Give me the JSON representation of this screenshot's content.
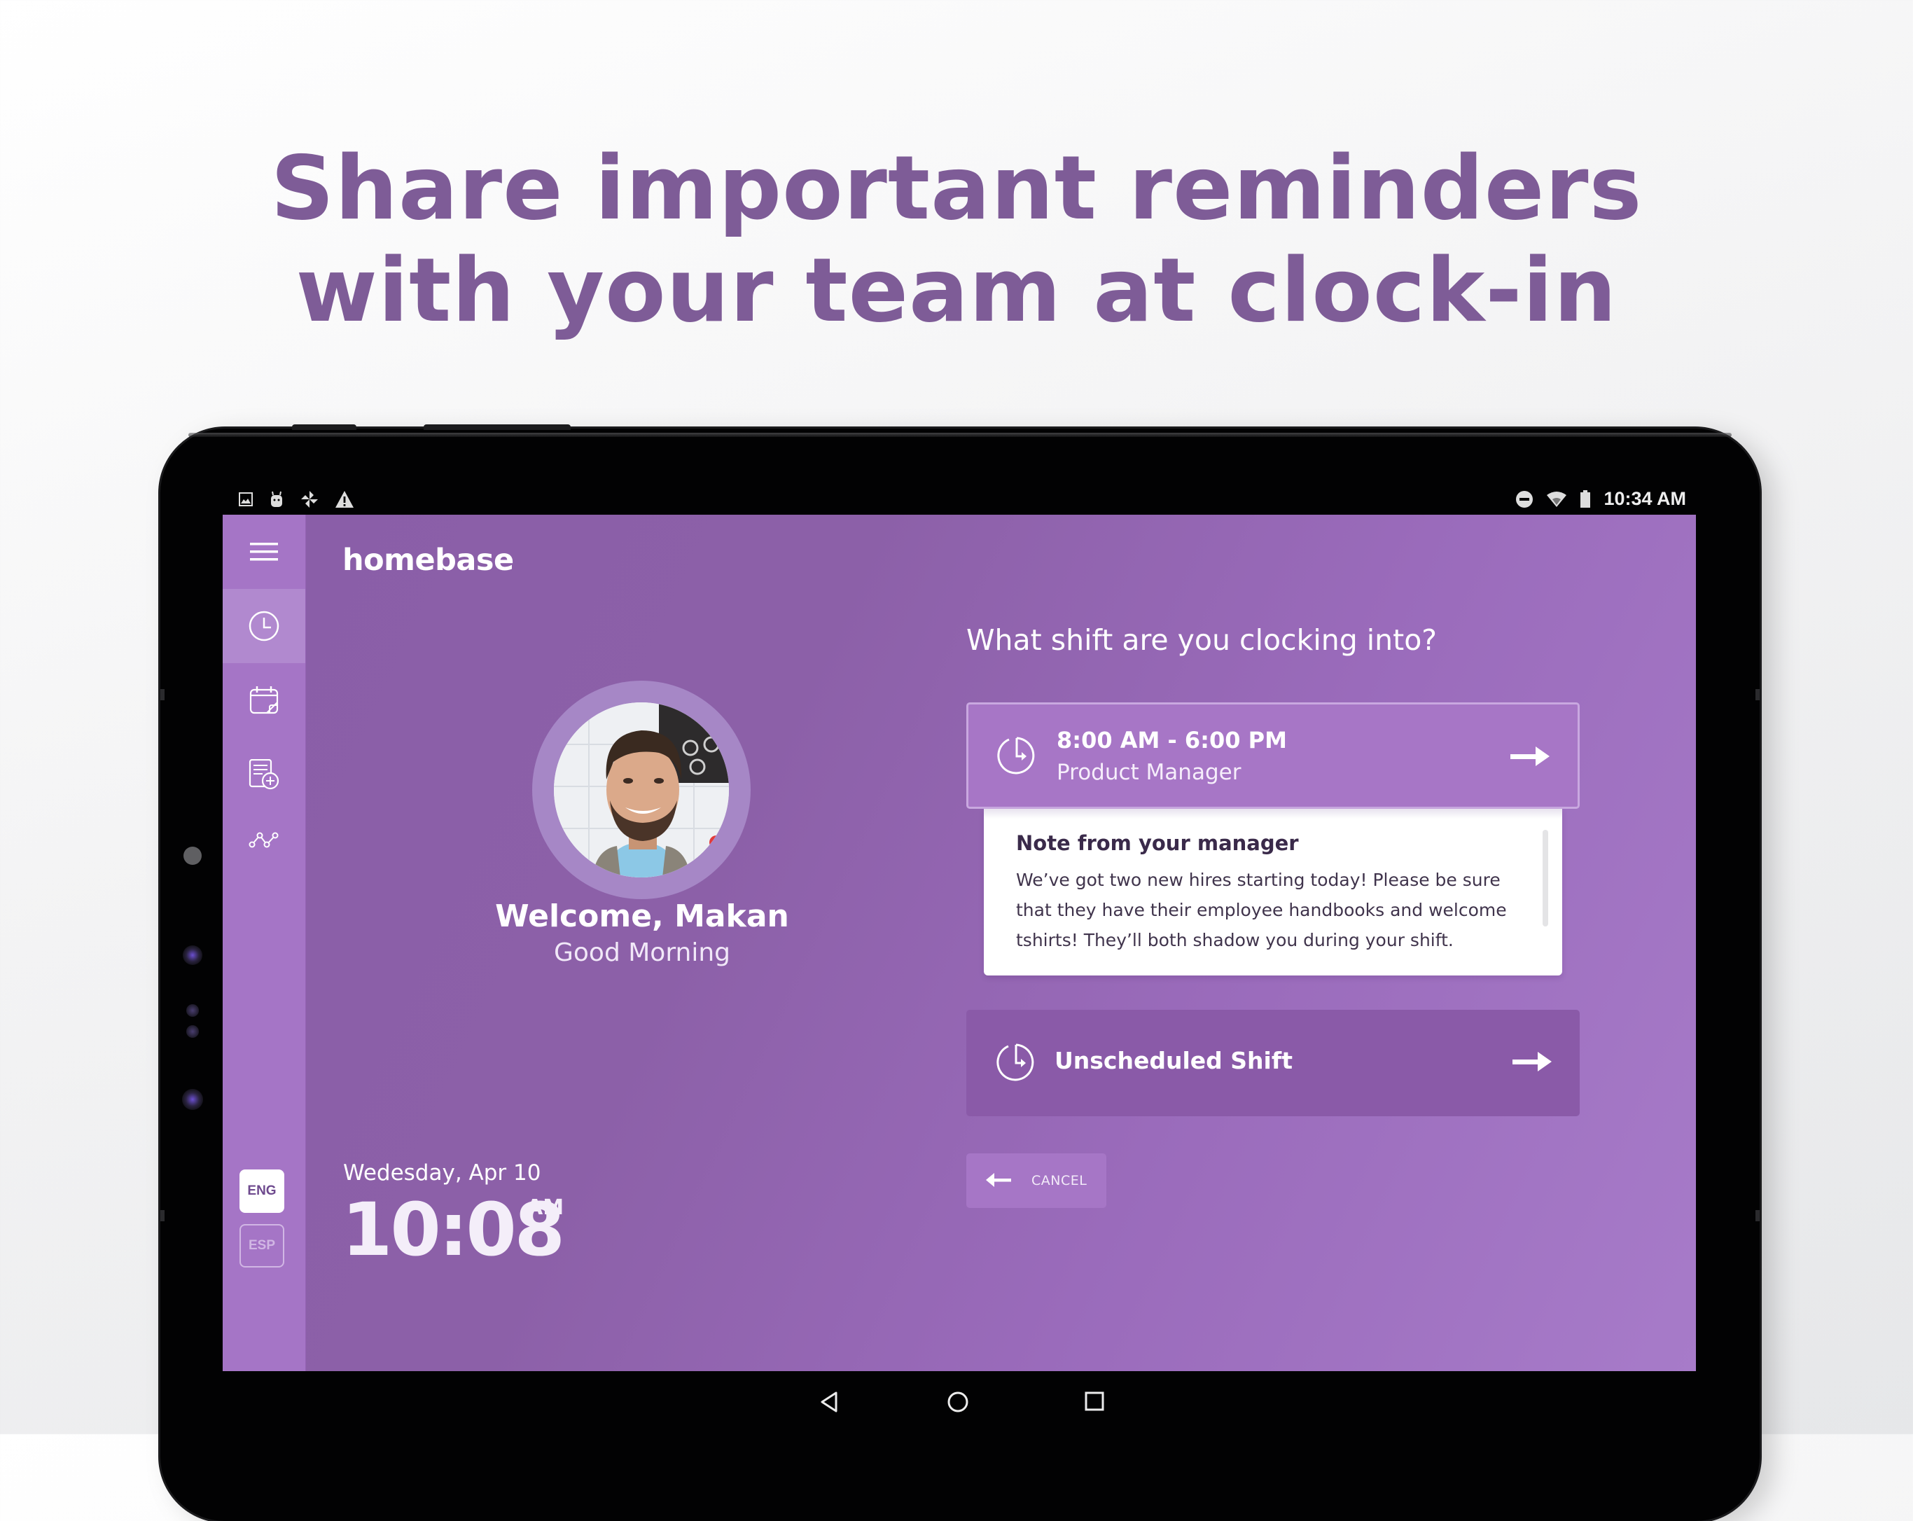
{
  "headline": {
    "line1": "Share important reminders",
    "line2": "with your team at clock-in"
  },
  "status_bar": {
    "left_icons": [
      "image-icon",
      "android-debug-icon",
      "pinwheel-icon",
      "warning-icon"
    ],
    "right_icons": [
      "do-not-disturb-icon",
      "wifi-icon",
      "battery-icon"
    ],
    "time": "10:34 AM"
  },
  "app": {
    "brand": "homebase",
    "colors": {
      "primary": "#8a5ea8",
      "sidebar": "#a575c6",
      "card": "#a776c6",
      "headline": "#7e5c97"
    },
    "sidebar": {
      "menu_icon": "hamburger-menu-icon",
      "items": [
        {
          "name": "clock",
          "icon": "clock-icon",
          "active": true
        },
        {
          "name": "schedule",
          "icon": "calendar-note-icon",
          "active": false
        },
        {
          "name": "new-document",
          "icon": "document-add-icon",
          "active": false
        },
        {
          "name": "analytics",
          "icon": "line-graph-icon",
          "active": false
        }
      ],
      "languages": [
        {
          "code": "ENG",
          "selected": true
        },
        {
          "code": "ESP",
          "selected": false
        }
      ]
    },
    "profile": {
      "welcome": "Welcome, Makan",
      "greeting": "Good Morning"
    },
    "clock": {
      "date": "Wedesday, Apr 10",
      "time": "10:08",
      "ampm": "AM"
    },
    "shift_picker": {
      "question": "What shift are you clocking into?",
      "scheduled_shift": {
        "time_range": "8:00 AM - 6:00 PM",
        "role": "Product Manager"
      },
      "manager_note": {
        "title": "Note from your manager",
        "body": "We’ve got two new hires starting today! Please be sure that they have their employee handbooks and welcome tshirts! They’ll both shadow you during your shift."
      },
      "unscheduled_label": "Unscheduled Shift",
      "cancel_label": "CANCEL"
    }
  },
  "nav_bar": {
    "buttons": [
      "back",
      "home",
      "recents"
    ]
  }
}
